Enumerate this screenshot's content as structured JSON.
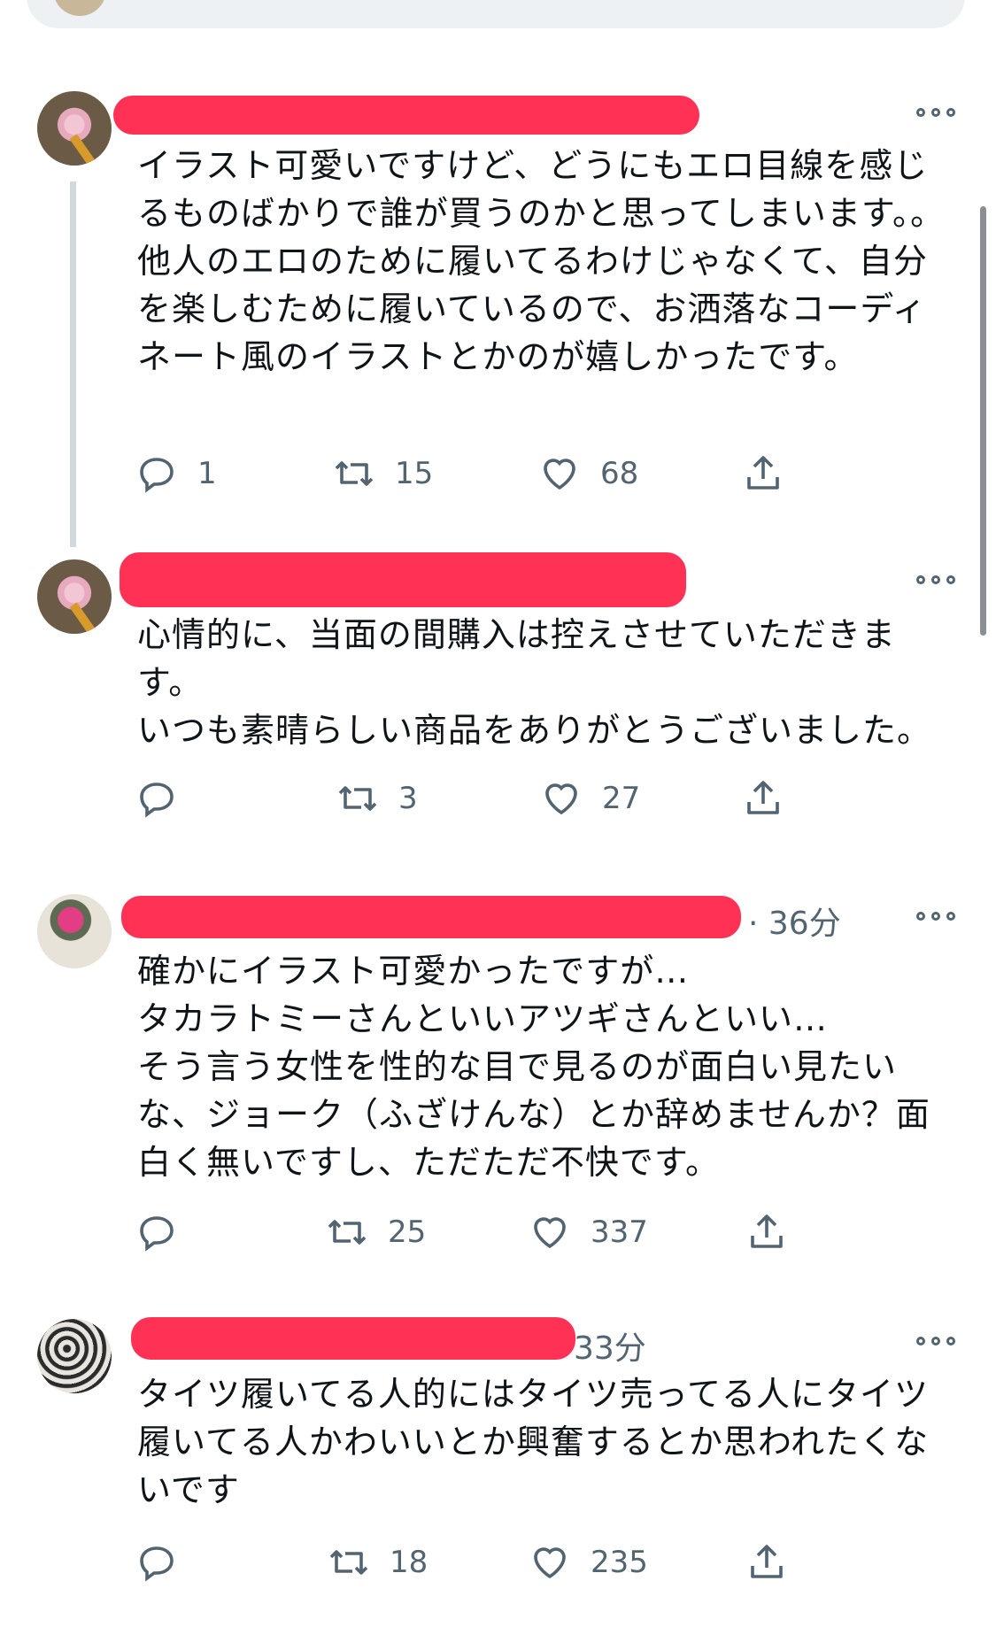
{
  "tweets": [
    {
      "time": "",
      "text": "イラスト可愛いですけど、どうにもエロ目線を感じるものばかりで誰が買うのかと思ってしまいます。。\n他人のエロのために履いてるわけじゃなくて、自分を楽しむために履いているので、お洒落なコーディネート風のイラストとかのが嬉しかったです。",
      "replies": "1",
      "retweets": "15",
      "likes": "68"
    },
    {
      "time": "",
      "text": "心情的に、当面の間購入は控えさせていただきます。\nいつも素晴らしい商品をありがとうございました。",
      "replies": "",
      "retweets": "3",
      "likes": "27"
    },
    {
      "time": "· 36分",
      "text": "確かにイラスト可愛かったですが…\nタカラトミーさんといいアツギさんといい…\nそう言う女性を性的な目で見るのが面白い見たいな、ジョーク（ふざけんな）とか辞めませんか？面白く無いですし、ただただ不快です。",
      "replies": "",
      "retweets": "25",
      "likes": "337"
    },
    {
      "time": "33分",
      "text": "タイツ履いてる人的にはタイツ売ってる人にタイツ履いてる人かわいいとか興奮するとか思われたくないです",
      "replies": "",
      "retweets": "18",
      "likes": "235"
    }
  ],
  "icons": [
    "more-icon",
    "reply-icon",
    "retweet-icon",
    "like-icon",
    "share-icon"
  ]
}
